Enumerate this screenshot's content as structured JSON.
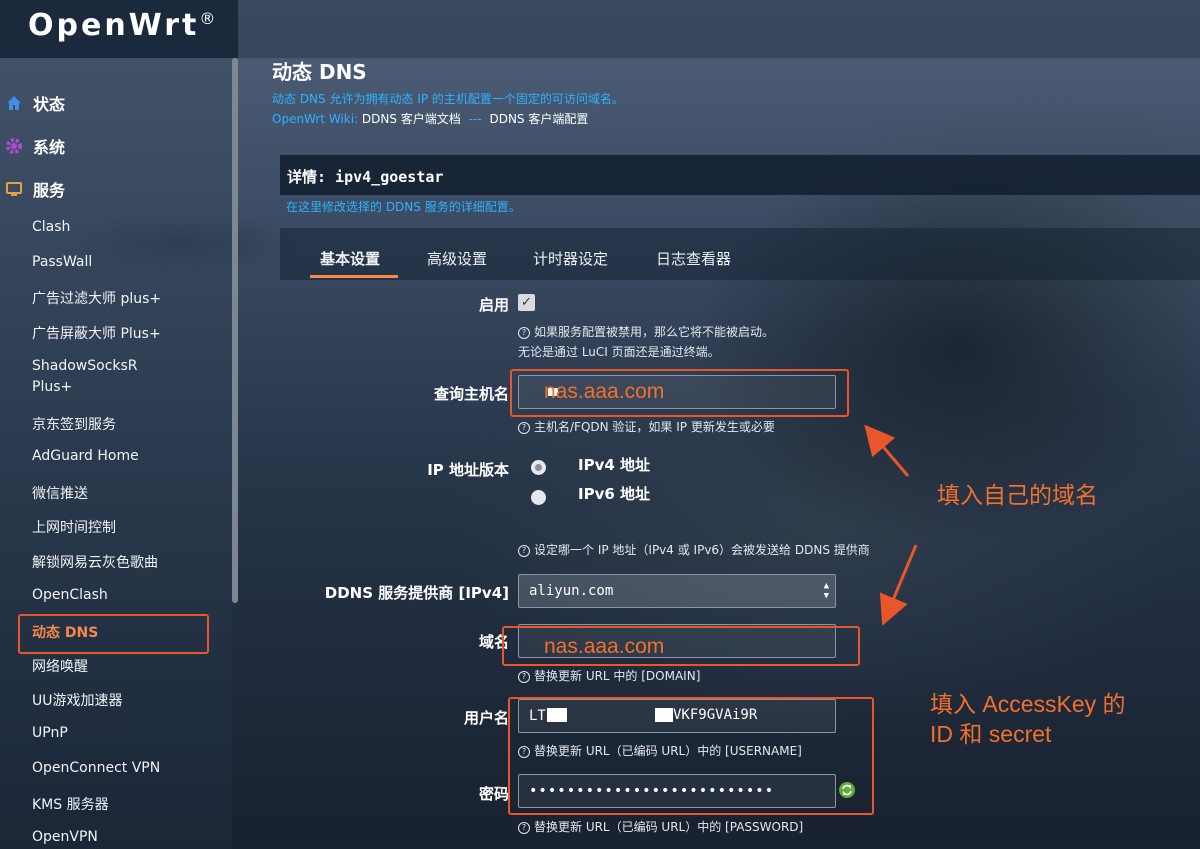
{
  "brand": {
    "name": "OpenWrt",
    "mark": "®"
  },
  "sidebar": {
    "top_items": [
      {
        "label": "状态",
        "icon": "home-icon"
      },
      {
        "label": "系统",
        "icon": "gear-icon"
      },
      {
        "label": "服务",
        "icon": "services-icon"
      }
    ],
    "items": [
      "Clash",
      "PassWall",
      "广告过滤大师 plus+",
      "广告屏蔽大师 Plus+",
      "ShadowSocksR",
      "Plus+",
      "京东签到服务",
      "AdGuard Home",
      "微信推送",
      "上网时间控制",
      "解锁网易云灰色歌曲",
      "OpenClash",
      "动态 DNS",
      "网络唤醒",
      "UU游戏加速器",
      "UPnP",
      "OpenConnect VPN",
      "KMS 服务器",
      "OpenVPN"
    ]
  },
  "page": {
    "title": "动态 DNS",
    "description": "动态 DNS 允许为拥有动态 IP 的主机配置一个固定的可访问域名。",
    "wiki_prefix": "OpenWrt Wiki:",
    "wiki_link1": "DDNS 客户端文档",
    "wiki_sep": "---",
    "wiki_link2": "DDNS 客户端配置"
  },
  "detail": {
    "title": "详情: ipv4_goestar",
    "description": "在这里修改选择的 DDNS 服务的详细配置。"
  },
  "tabs": [
    "基本设置",
    "高级设置",
    "计时器设定",
    "日志查看器"
  ],
  "form": {
    "enable_label": "启用",
    "enable_checked": true,
    "enable_help1": "如果服务配置被禁用，那么它将不能被启动。",
    "enable_help2": "无论是通过 LuCI 页面还是通过终端。",
    "lookup_label": "查询主机名",
    "lookup_help": "主机名/FQDN 验证，如果 IP 更新发生或必要",
    "ipver_label": "IP 地址版本",
    "ipv4_option": "IPv4 地址",
    "ipv6_option": "IPv6 地址",
    "ipver_selected": "IPv4 地址",
    "ipver_help": "设定哪一个 IP 地址（IPv4 或 IPv6）会被发送给 DDNS 提供商",
    "provider_label": "DDNS 服务提供商 [IPv4]",
    "provider_value": "aliyun.com",
    "domain_label": "域名",
    "domain_help": "替换更新 URL 中的 [DOMAIN]",
    "username_label": "用户名",
    "username_value_start": "LT",
    "username_value_end": "VKF9GVAi9R",
    "username_help": "替换更新 URL（已编码 URL）中的 [USERNAME]",
    "password_label": "密码",
    "password_value": "••••••••••••••••••••••••••",
    "password_help": "替换更新 URL（已编码 URL）中的 [PASSWORD]"
  },
  "annotations": {
    "lookup_overlay": "nas.aaa.com",
    "domain_overlay": "nas.aaa.com",
    "fill_domain": "填入自己的域名",
    "fill_key_line1": "填入 AccessKey 的",
    "fill_key_line2": "ID 和 secret",
    "accent_color": "#f3702a"
  }
}
